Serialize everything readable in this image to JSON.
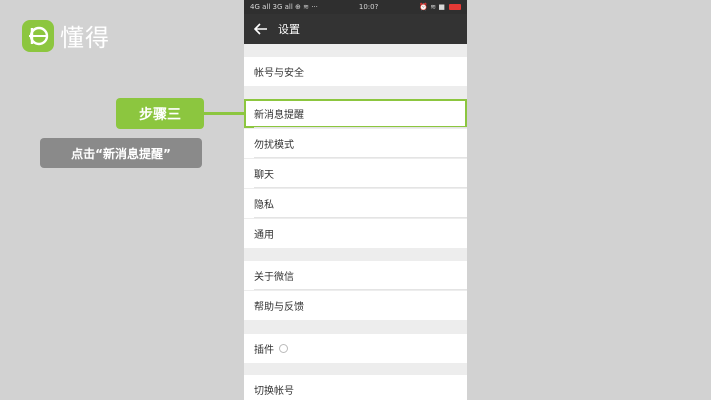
{
  "brand": {
    "name": "懂得",
    "color": "#8cc63f"
  },
  "phone": {
    "status": {
      "carrier": "4G all 3G all ⊕ ≋ ···",
      "time": "10:0?",
      "icons": "⏰ ≋ ■"
    },
    "header": {
      "title": "设置",
      "back_icon": "arrow-left-icon"
    },
    "sections": [
      {
        "items": [
          "帐号与安全"
        ]
      },
      {
        "items": [
          "新消息提醒",
          "勿扰模式",
          "聊天",
          "隐私",
          "通用"
        ]
      },
      {
        "items": [
          "关于微信",
          "帮助与反馈"
        ]
      },
      {
        "items": [
          "插件"
        ]
      },
      {
        "items": [
          "切换帐号"
        ]
      }
    ]
  },
  "annotation": {
    "step": "步骤三",
    "instruction": "点击“新消息提醒”"
  }
}
